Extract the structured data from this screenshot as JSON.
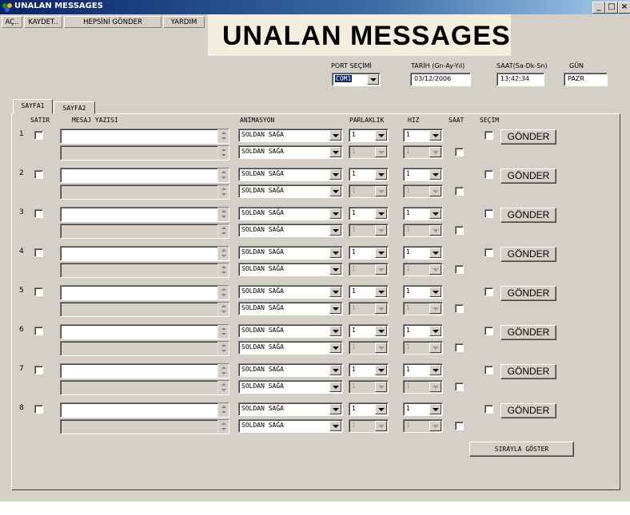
{
  "window": {
    "title": "UNALAN MESSAGES",
    "minimize": "_",
    "maximize": "□",
    "close": "×"
  },
  "menu": [
    "AÇ..",
    "KAYDET..",
    "HEPSİNİ GÖNDER",
    "YARDIM"
  ],
  "banner": "UNALAN  MESSAGES",
  "port": {
    "label": "PORT SEÇİMİ",
    "value": "COM1"
  },
  "date": {
    "label": "TARİH (Gn-Ay-Yıl)",
    "value": "03/12/2006"
  },
  "time": {
    "label": "SAAT(Sa-Dk-Sn)",
    "value": "13:42:34"
  },
  "day": {
    "label": "GÜN",
    "value": "PAZR"
  },
  "tabs": [
    "SAYFA1",
    "SAYFA2"
  ],
  "columns": {
    "row": "SATIR",
    "message": "MESAJ YAZISI",
    "animation": "ANİMASYON",
    "brightness": "PARLAKLIK",
    "speed": "HIZ",
    "clock": "SAAT",
    "select": "SEÇİM"
  },
  "rows": [
    {
      "num": "1",
      "animation1": "SOLDAN SAĞA",
      "animation2": "SOLDAN SAĞA",
      "brightness": "1",
      "speed": "1",
      "brightness2": "1",
      "speed2": "1",
      "send": "GÖNDER"
    },
    {
      "num": "2",
      "animation1": "SOLDAN SAĞA",
      "animation2": "SOLDAN SAĞA",
      "brightness": "1",
      "speed": "1",
      "brightness2": "1",
      "speed2": "1",
      "send": "GÖNDER"
    },
    {
      "num": "3",
      "animation1": "SOLDAN SAĞA",
      "animation2": "SOLDAN SAĞA",
      "brightness": "1",
      "speed": "1",
      "brightness2": "1",
      "speed2": "1",
      "send": "GÖNDER"
    },
    {
      "num": "4",
      "animation1": "SOLDAN SAĞA",
      "animation2": "SOLDAN SAĞA",
      "brightness": "1",
      "speed": "1",
      "brightness2": "1",
      "speed2": "1",
      "send": "GÖNDER"
    },
    {
      "num": "5",
      "animation1": "SOLDAN SAĞA",
      "animation2": "SOLDAN SAĞA",
      "brightness": "1",
      "speed": "1",
      "brightness2": "1",
      "speed2": "1",
      "send": "GÖNDER"
    },
    {
      "num": "6",
      "animation1": "SOLDAN SAĞA",
      "animation2": "SOLDAN SAĞA",
      "brightness": "1",
      "speed": "1",
      "brightness2": "1",
      "speed2": "1",
      "send": "GÖNDER"
    },
    {
      "num": "7",
      "animation1": "SOLDAN SAĞA",
      "animation2": "SOLDAN SAĞA",
      "brightness": "1",
      "speed": "1",
      "brightness2": "1",
      "speed2": "1",
      "send": "GÖNDER"
    },
    {
      "num": "8",
      "animation1": "SOLDAN SAĞA",
      "animation2": "SOLDAN SAĞA",
      "brightness": "1",
      "speed": "1",
      "brightness2": "1",
      "speed2": "1",
      "send": "GÖNDER"
    }
  ],
  "show_sequential": "SIRAYLA GÖSTER"
}
